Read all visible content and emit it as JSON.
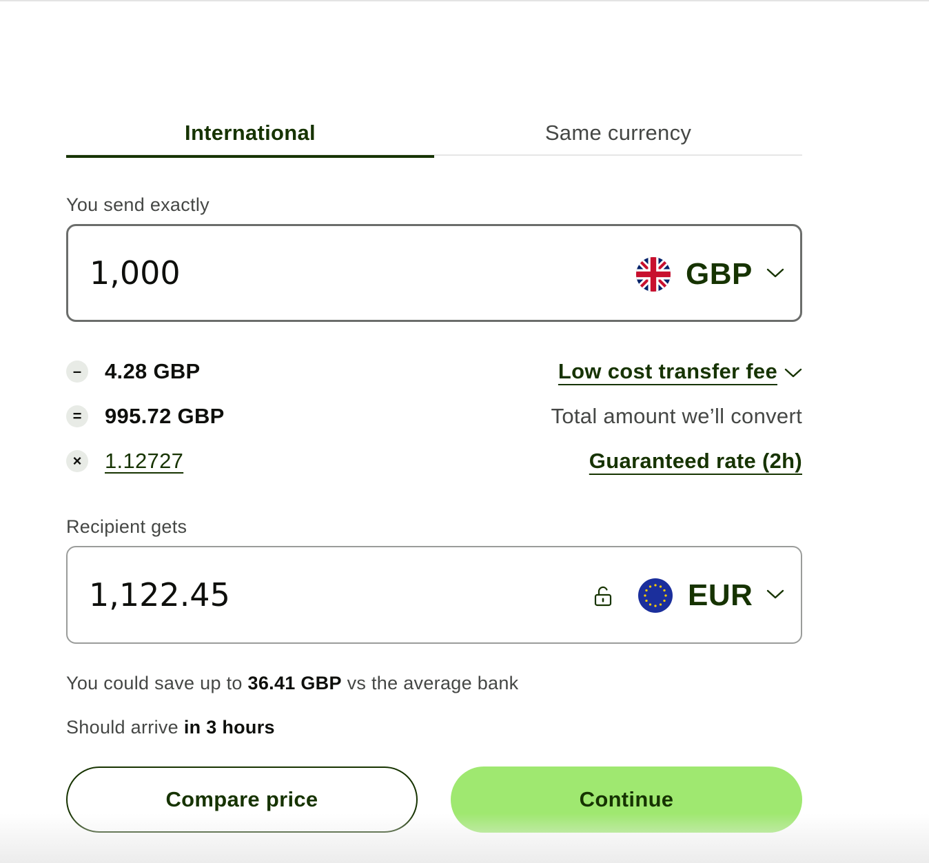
{
  "tabs": [
    {
      "label": "International",
      "active": true
    },
    {
      "label": "Same currency",
      "active": false
    }
  ],
  "send": {
    "label": "You send exactly",
    "amount": "1,000",
    "currency": "GBP",
    "flag_icon": "uk-flag-icon"
  },
  "fees": {
    "fee_amount": "4.28 GBP",
    "fee_label": "Low cost transfer fee",
    "convert_amount": "995.72 GBP",
    "convert_label": "Total amount we’ll convert",
    "rate": "1.12727",
    "rate_label": "Guaranteed rate (2h)",
    "ops": [
      "–",
      "=",
      "×"
    ]
  },
  "receive": {
    "label": "Recipient gets",
    "amount": "1,122.45",
    "currency": "EUR",
    "flag_icon": "eu-flag-icon",
    "lock_icon": "unlock-icon"
  },
  "savings": {
    "prefix": "You could save up to",
    "amount": "36.41 GBP",
    "suffix": "vs the average bank"
  },
  "arrival": {
    "prefix": "Should arrive",
    "time": "in 3 hours"
  },
  "buttons": {
    "compare": "Compare price",
    "continue": "Continue"
  },
  "colors": {
    "brand_dark_green": "#163300",
    "brand_bright_green": "#9fe870",
    "muted_text": "#454745"
  }
}
